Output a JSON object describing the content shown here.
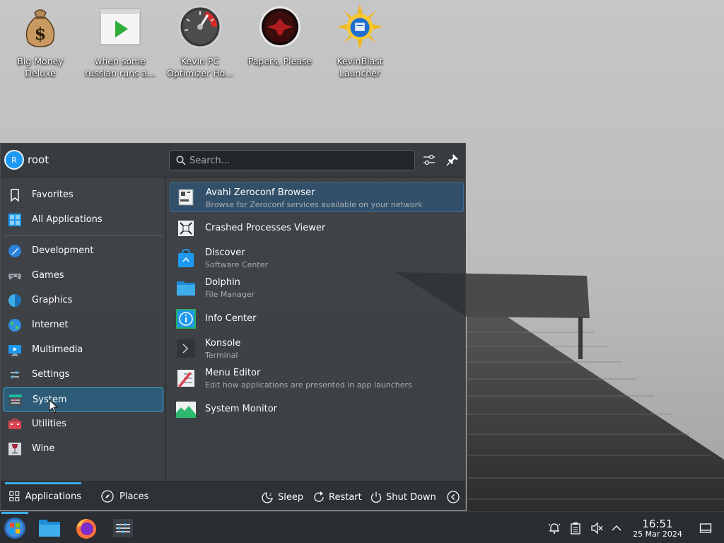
{
  "desktop": {
    "icons": [
      {
        "label": "Big Money\nDeluxe",
        "icon": "money-bag-icon"
      },
      {
        "label": "when some\nrussian runs a...",
        "icon": "video-play-icon"
      },
      {
        "label": "Kevin PC\nOptimizer Ho...",
        "icon": "speedometer-icon"
      },
      {
        "label": "Papers, Please",
        "icon": "eagle-emblem-icon"
      },
      {
        "label": "KevinBlast\nLauncher",
        "icon": "sun-disc-icon"
      }
    ]
  },
  "launcher": {
    "user": {
      "initial": "R",
      "name": "root"
    },
    "search": {
      "placeholder": "Search..."
    },
    "categories": [
      {
        "label": "Favorites",
        "icon": "bookmark-icon"
      },
      {
        "label": "All Applications",
        "icon": "grid-icon"
      },
      {
        "label": "Development",
        "icon": "development-icon"
      },
      {
        "label": "Games",
        "icon": "gamepad-icon"
      },
      {
        "label": "Graphics",
        "icon": "graphics-icon"
      },
      {
        "label": "Internet",
        "icon": "globe-icon"
      },
      {
        "label": "Multimedia",
        "icon": "multimedia-icon"
      },
      {
        "label": "Settings",
        "icon": "settings-icon"
      },
      {
        "label": "System",
        "icon": "system-icon",
        "selected": true
      },
      {
        "label": "Utilities",
        "icon": "utilities-icon"
      },
      {
        "label": "Wine",
        "icon": "wine-icon"
      }
    ],
    "apps": [
      {
        "name": "Avahi Zeroconf Browser",
        "desc": "Browse for Zeroconf services available on your network",
        "icon": "network-browser-icon"
      },
      {
        "name": "Crashed Processes Viewer",
        "desc": "",
        "icon": "crash-icon"
      },
      {
        "name": "Discover",
        "desc": "Software Center",
        "icon": "shopping-bag-icon"
      },
      {
        "name": "Dolphin",
        "desc": "File Manager",
        "icon": "folder-icon"
      },
      {
        "name": "Info Center",
        "desc": "",
        "icon": "info-icon"
      },
      {
        "name": "Konsole",
        "desc": "Terminal",
        "icon": "terminal-icon"
      },
      {
        "name": "Menu Editor",
        "desc": "Edit how applications are presented in app launchers",
        "icon": "menu-editor-icon"
      },
      {
        "name": "System Monitor",
        "desc": "",
        "icon": "system-monitor-icon"
      }
    ],
    "footer": {
      "tabs": [
        {
          "label": "Applications",
          "active": true
        },
        {
          "label": "Places",
          "active": false
        }
      ],
      "power": [
        {
          "label": "Sleep",
          "icon": "sleep-icon"
        },
        {
          "label": "Restart",
          "icon": "restart-icon"
        },
        {
          "label": "Shut Down",
          "icon": "power-icon"
        }
      ]
    }
  },
  "panel": {
    "tasks": [
      "start-menu-icon",
      "file-manager-icon",
      "firefox-icon",
      "system-settings-icon"
    ],
    "tray": [
      "notifications-icon",
      "clipboard-icon",
      "volume-muted-icon",
      "expand-tray-icon"
    ],
    "clock": {
      "time": "16:51",
      "date": "25 Mar 2024"
    }
  },
  "colors": {
    "accent": "#3daee9",
    "panel": "#2a2e32",
    "launcher": "#2d3136"
  }
}
